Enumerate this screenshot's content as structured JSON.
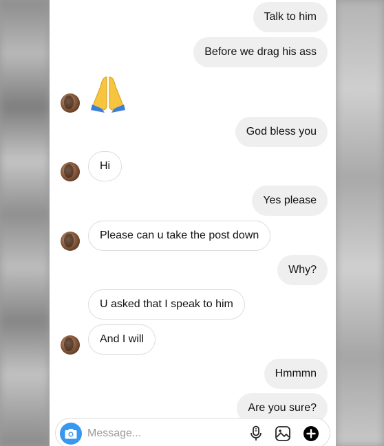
{
  "messages": [
    {
      "text": "Talk to him"
    },
    {
      "text": "Before we drag his ass"
    },
    {
      "text": "God bless you"
    },
    {
      "text": "Hi"
    },
    {
      "text": "Yes please"
    },
    {
      "text": "Please can u take the post down"
    },
    {
      "text": "Why?"
    },
    {
      "text": "U asked that I speak to him"
    },
    {
      "text": "And I will"
    },
    {
      "text": "Hmmmn"
    },
    {
      "text": "Are you sure?"
    }
  ],
  "emoji": {
    "icon": "folded-hands-icon"
  },
  "composer": {
    "placeholder": "Message...",
    "icons": [
      "camera-icon",
      "microphone-icon",
      "gallery-icon",
      "plus-icon"
    ]
  },
  "colors": {
    "sent_bubble": "#efefef",
    "received_border": "#dcdcdc",
    "camera_button": "#3897f0"
  }
}
